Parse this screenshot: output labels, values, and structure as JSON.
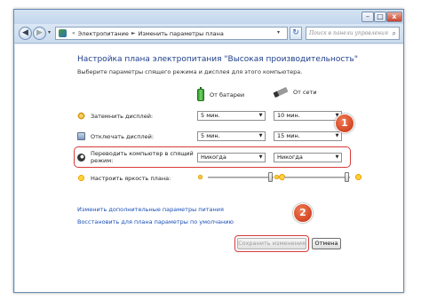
{
  "window": {
    "controls": {
      "minimize": "–",
      "maximize": "□",
      "close": "x"
    }
  },
  "nav": {
    "back_glyph": "◀",
    "forward_glyph": "▶",
    "dropdown_glyph": "▾",
    "refresh_glyph": "↻",
    "address": {
      "icon": "control-panel-icon",
      "separator": "«",
      "separator2": "►",
      "crumbs": [
        "Электропитание",
        "Изменить параметры плана"
      ]
    },
    "search_placeholder": "Поиск в панели управления",
    "search_glyph": "⌕"
  },
  "page": {
    "title": "Настройка плана электропитания \"Высокая производительность\"",
    "subtitle": "Выберите параметры спящего режима и дисплея для этого компьютера."
  },
  "columns": {
    "battery": "От батареи",
    "plugged": "От сети"
  },
  "settings": {
    "dim_display": {
      "label": "Затемнить дисплей:",
      "battery": "5 мин.",
      "plugged": "10 мин."
    },
    "turn_off_display": {
      "label": "Отключать дисплей:",
      "battery": "5 мин.",
      "plugged": "15 мин."
    },
    "sleep": {
      "label_line1": "Переводить компьютер в спящий",
      "label_line2": "режим:",
      "battery": "Никогда",
      "plugged": "Никогда"
    },
    "brightness": {
      "label": "Настроить яркость плана:",
      "battery_level": 0.9,
      "plugged_level": 0.9
    }
  },
  "select_arrow": "▼",
  "links": {
    "advanced": "Изменить дополнительные параметры питания",
    "restore": "Восстановить для плана параметры по умолчанию"
  },
  "buttons": {
    "save": "Сохранить изменения",
    "cancel": "Отмена"
  },
  "annotations": {
    "badge1": "1",
    "badge2": "2"
  },
  "colors": {
    "title": "#1f3f8a",
    "link": "#1a4fb5",
    "highlight": "#d83a3a",
    "badge": "#d8401c"
  }
}
